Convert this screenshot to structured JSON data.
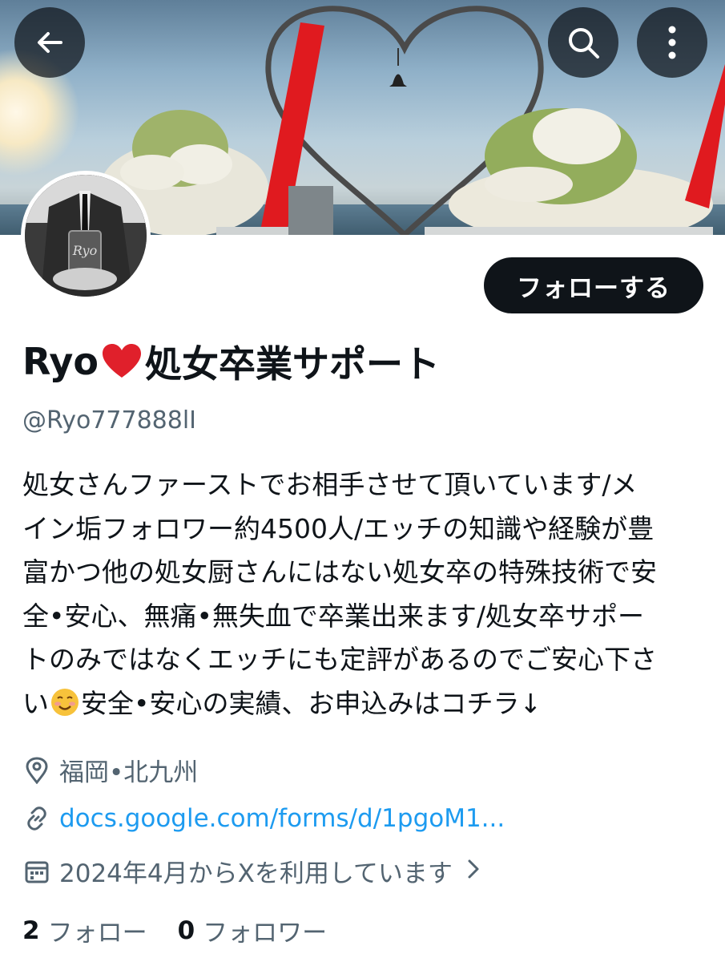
{
  "header": {
    "back_icon": "arrow-left-icon",
    "search_icon": "search-icon",
    "more_icon": "more-vertical-icon"
  },
  "profile": {
    "display_name_prefix": "Ryo",
    "display_name_emoji": "red-heart",
    "display_name_suffix": "処女卒業サポート",
    "handle": "@Ryo777888lI",
    "follow_label": "フォローする",
    "bio_lines": [
      "処女さんファーストでお相手させて頂いています/メ",
      "イン垢フォロワー約4500人/エッチの知識や経験が豊",
      "富かつ他の処女厨さんにはない処女卒の特殊技術で安",
      "全•安心、無痛•無失血で卒業出来ます/処女卒サポー",
      "トのみではなくエッチにも定評があるのでご安心下さ"
    ],
    "bio_last_line_prefix": "い",
    "bio_last_line_emoji": "smiling-face",
    "bio_last_line_suffix": "安全•安心の実績、お申込みはコチラ↓",
    "location": "福岡•北九州",
    "link": "docs.google.com/forms/d/1pgoM1...",
    "joined": "2024年4月からXを利用しています",
    "following_count": "2",
    "following_label": "フォロー",
    "followers_count": "0",
    "followers_label": "フォロワー"
  },
  "colors": {
    "text_primary": "#0f1419",
    "text_secondary": "#536471",
    "link": "#1d9bf0",
    "button_bg": "#0f1419"
  }
}
